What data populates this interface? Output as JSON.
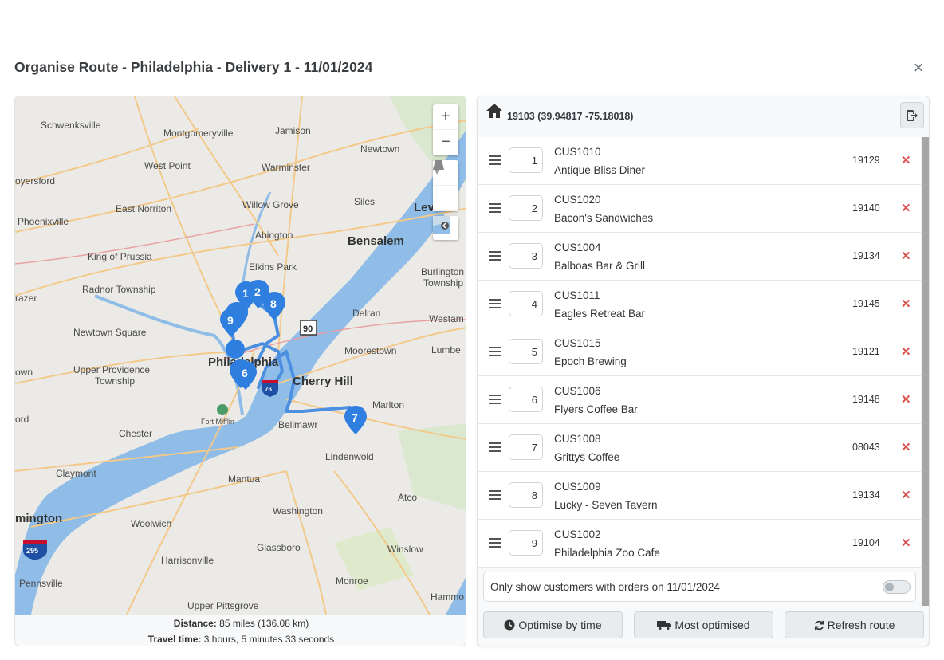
{
  "modal": {
    "title": "Organise Route - Philadelphia - Delivery 1 - 11/01/2024",
    "close_label": "×"
  },
  "map": {
    "places": [
      "Schwenksville",
      "Montgomeryville",
      "Jamison",
      "Newtown",
      "West Point",
      "Warminster",
      "oyersford",
      "East Norriton",
      "Willow Grove",
      "Siles",
      "Lev",
      "Phoenixville",
      "Abington",
      "Bensalem",
      "King of Prussia",
      "Elkins Park",
      "Burlington",
      "Township",
      "Radnor Township",
      "razer",
      "Delran",
      "Westam",
      "Newtown Square",
      "Moorestown",
      "Lumbe",
      "Philadelphia",
      "Cherry Hill",
      "own",
      "Upper Providence",
      "Township",
      "Marlton",
      "Fort Mifflin",
      "ord",
      "Chester",
      "Bellmawr",
      "Lindenwold",
      "Claymont",
      "Mantua",
      "Atco",
      "Washington",
      "mington",
      "Woolwich",
      "Glassboro",
      "Winslow",
      "Harrisonville",
      "Monroe",
      "Pennsville",
      "Upper Pittsgrove",
      "Hammo"
    ],
    "highway_shields": [
      "90",
      "295",
      "76"
    ],
    "markers": [
      "1",
      "2",
      "5",
      "8",
      "9",
      "6",
      "7"
    ],
    "controls": {
      "zoom_in": "+",
      "zoom_out": "−"
    },
    "distance_label": "Distance:",
    "distance_value": "85 miles (136.08 km)",
    "travel_time_label": "Travel time:",
    "travel_time_value": "3 hours, 5 minutes 33 seconds"
  },
  "route": {
    "start": "19103 (39.94817 -75.18018)",
    "stops": [
      {
        "order": "1",
        "code": "CUS1010",
        "name": "Antique Bliss Diner",
        "zip": "19129"
      },
      {
        "order": "2",
        "code": "CUS1020",
        "name": "Bacon's Sandwiches",
        "zip": "19140"
      },
      {
        "order": "3",
        "code": "CUS1004",
        "name": "Balboas Bar & Grill",
        "zip": "19134"
      },
      {
        "order": "4",
        "code": "CUS1011",
        "name": "Eagles Retreat Bar",
        "zip": "19145"
      },
      {
        "order": "5",
        "code": "CUS1015",
        "name": "Epoch Brewing",
        "zip": "19121"
      },
      {
        "order": "6",
        "code": "CUS1006",
        "name": "Flyers Coffee Bar",
        "zip": "19148"
      },
      {
        "order": "7",
        "code": "CUS1008",
        "name": "Grittys Coffee",
        "zip": "08043"
      },
      {
        "order": "8",
        "code": "CUS1009",
        "name": "Lucky - Seven Tavern",
        "zip": "19134"
      },
      {
        "order": "9",
        "code": "CUS1002",
        "name": "Philadelphia Zoo Cafe",
        "zip": "19104"
      }
    ],
    "remove_label": "✕",
    "toggle_label": "Only show customers with orders on 11/01/2024",
    "buttons": {
      "optimise_time": "Optimise by time",
      "most_optimised": "Most optimised",
      "refresh": "Refresh route"
    }
  },
  "colors": {
    "accent": "#2f7fe0",
    "route_line": "#4a8fe0",
    "water": "#8fbde8",
    "remove": "#d9534f"
  }
}
